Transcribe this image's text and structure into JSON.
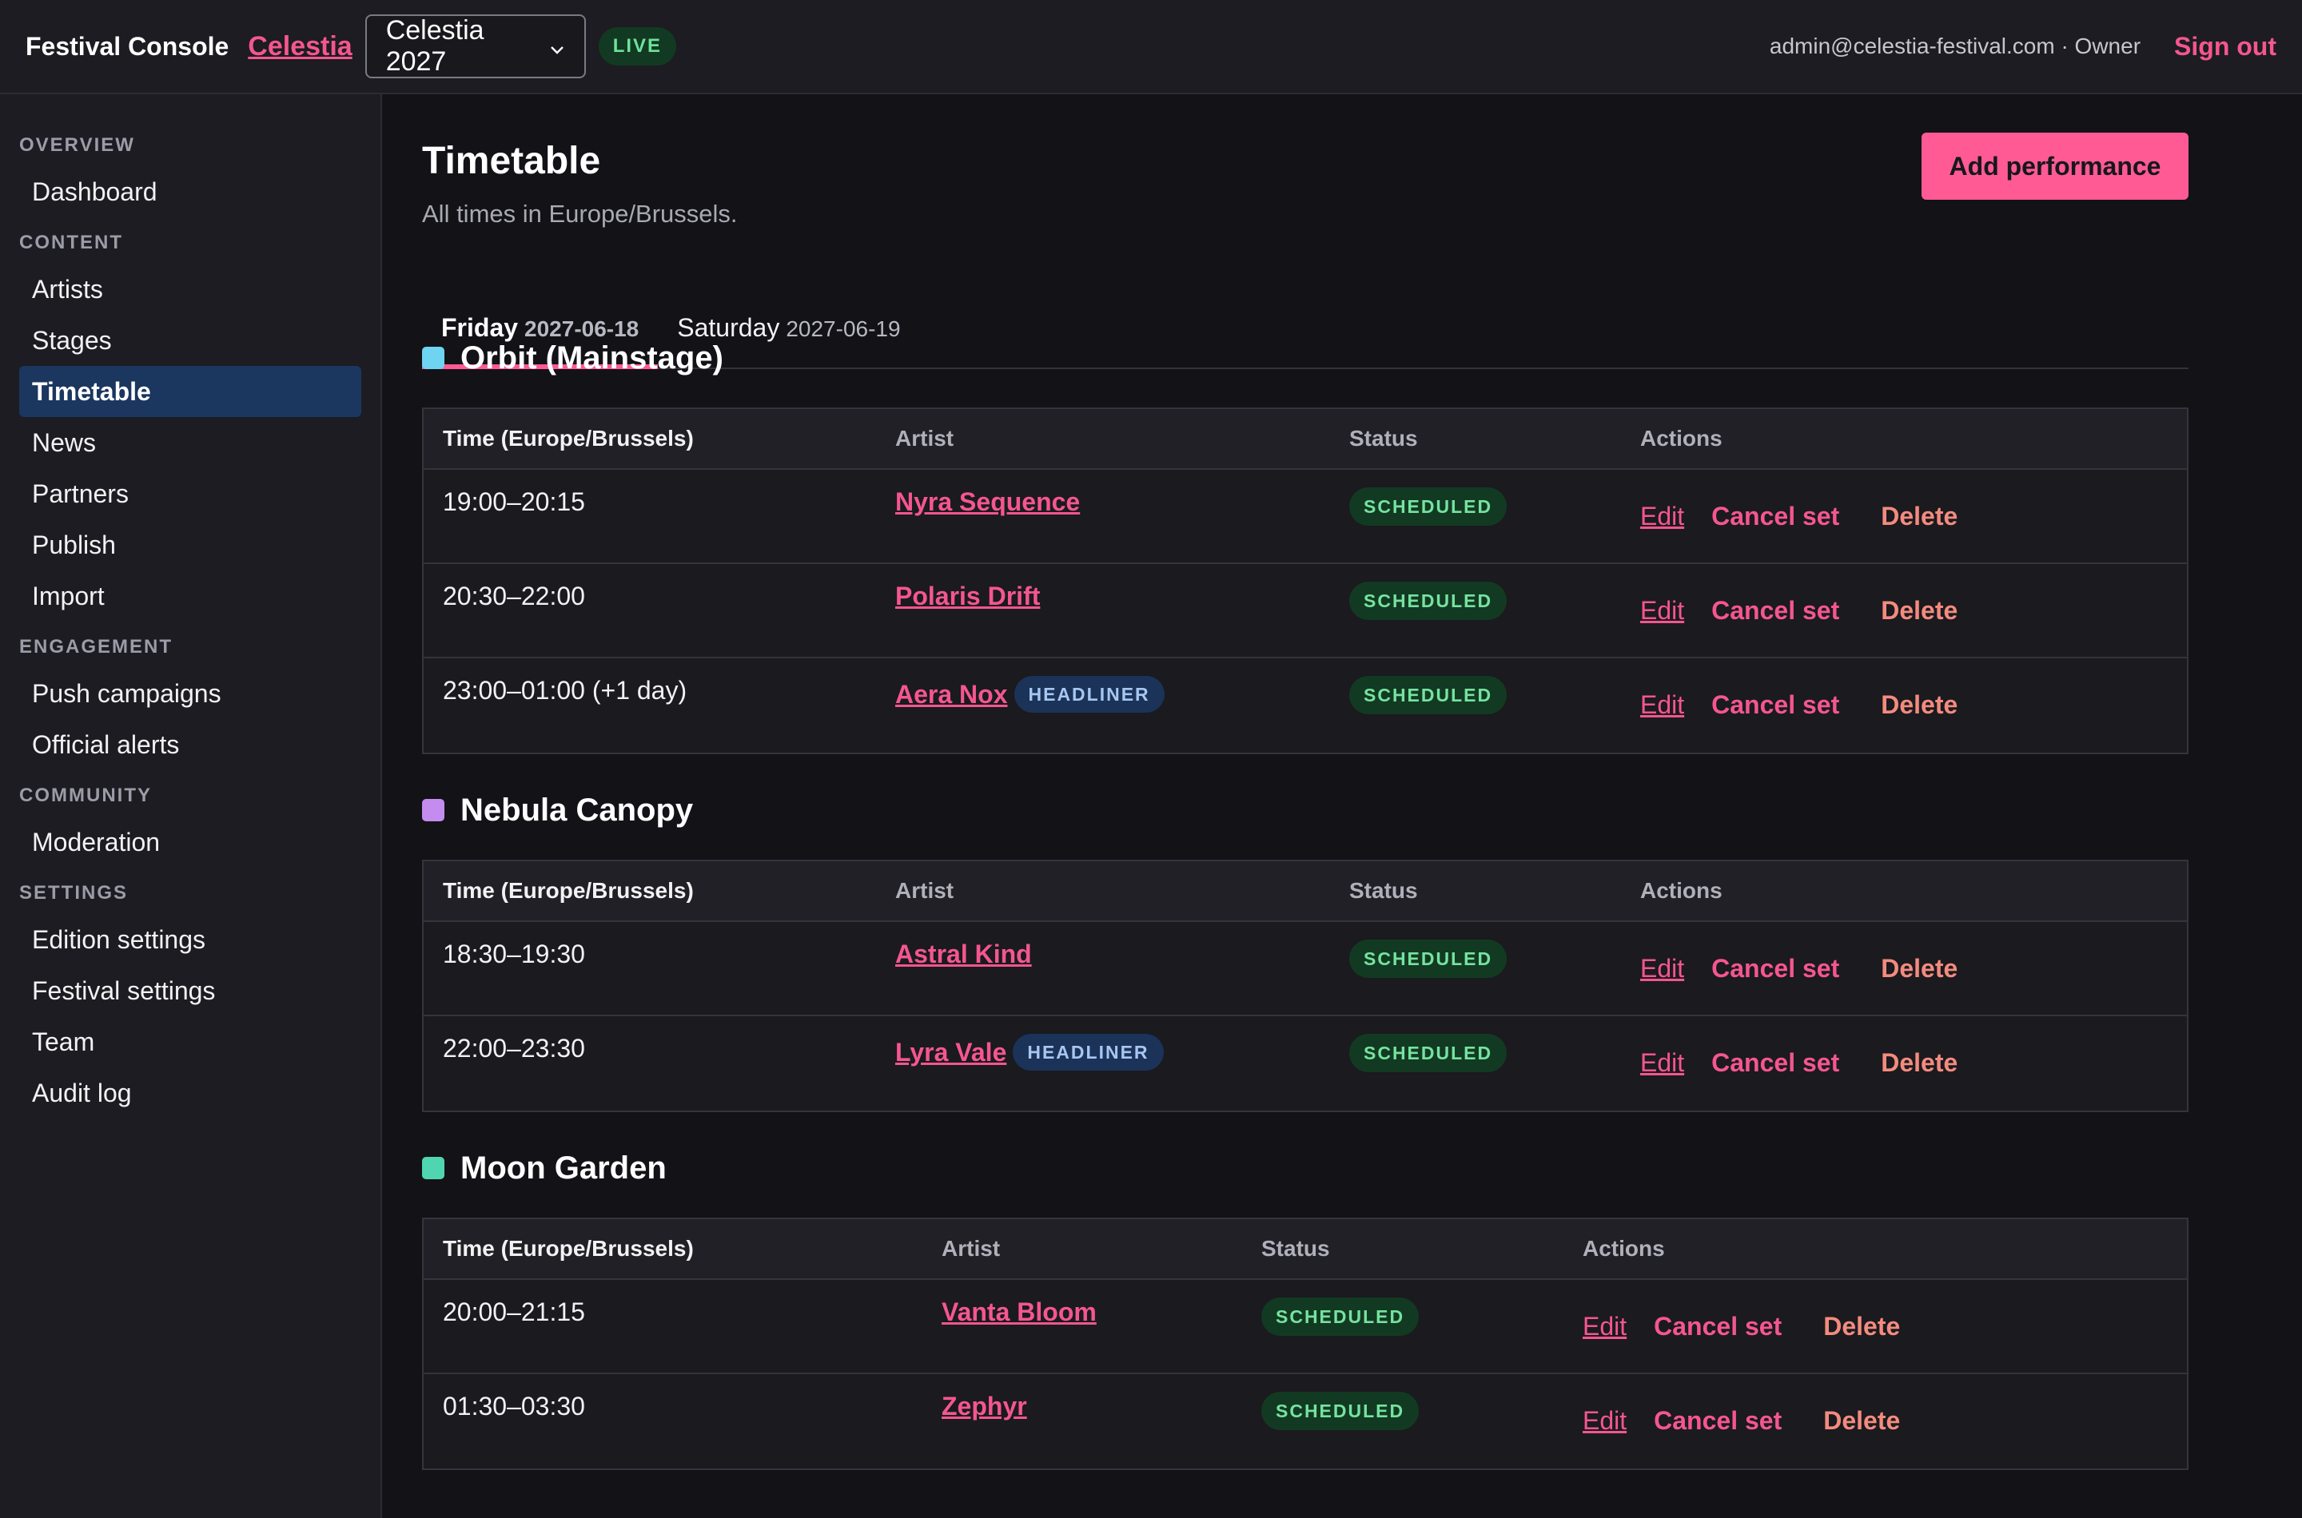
{
  "topbar": {
    "brand": "Festival Console",
    "festival_link": "Celestia",
    "edition_select": "Celestia 2027",
    "live_badge": "LIVE",
    "user_info": "admin@celestia-festival.com · Owner",
    "sign_out": "Sign out"
  },
  "sidebar": {
    "sections": [
      {
        "heading": "OVERVIEW",
        "items": [
          "Dashboard"
        ]
      },
      {
        "heading": "CONTENT",
        "items": [
          "Artists",
          "Stages",
          "Timetable",
          "News",
          "Partners",
          "Publish",
          "Import"
        ]
      },
      {
        "heading": "ENGAGEMENT",
        "items": [
          "Push campaigns",
          "Official alerts"
        ]
      },
      {
        "heading": "COMMUNITY",
        "items": [
          "Moderation"
        ]
      },
      {
        "heading": "SETTINGS",
        "items": [
          "Edition settings",
          "Festival settings",
          "Team",
          "Audit log"
        ]
      }
    ],
    "active_item": "Timetable"
  },
  "page": {
    "title": "Timetable",
    "subtitle": "All times in Europe/Brussels.",
    "add_button": "Add performance"
  },
  "tabs": [
    {
      "day": "Friday",
      "date": "2027-06-18",
      "active": true
    },
    {
      "day": "Saturday",
      "date": "2027-06-19",
      "active": false
    }
  ],
  "table_headers": {
    "time": "Time (Europe/Brussels)",
    "artist": "Artist",
    "status": "Status",
    "actions": "Actions"
  },
  "actions": {
    "edit": "Edit",
    "cancel": "Cancel set",
    "delete": "Delete"
  },
  "stages": [
    {
      "name": "Orbit (Mainstage)",
      "color": "#6fd3f2",
      "rows": [
        {
          "time": "19:00–20:15",
          "artist": "Nyra Sequence",
          "headliner": "",
          "status": "SCHEDULED"
        },
        {
          "time": "20:30–22:00",
          "artist": "Polaris Drift",
          "headliner": "",
          "status": "SCHEDULED"
        },
        {
          "time": "23:00–01:00 (+1 day)",
          "artist": "Aera Nox",
          "headliner": "HEADLINER",
          "status": "SCHEDULED"
        }
      ]
    },
    {
      "name": "Nebula Canopy",
      "color": "#c58cf0",
      "rows": [
        {
          "time": "18:30–19:30",
          "artist": "Astral Kind",
          "headliner": "",
          "status": "SCHEDULED"
        },
        {
          "time": "22:00–23:30",
          "artist": "Lyra Vale",
          "headliner": "HEADLINER",
          "status": "SCHEDULED"
        }
      ]
    },
    {
      "name": "Moon Garden",
      "color": "#4fd6b0",
      "rows": [
        {
          "time": "20:00–21:15",
          "artist": "Vanta Bloom",
          "headliner": "",
          "status": "SCHEDULED"
        },
        {
          "time": "01:30–03:30",
          "artist": "Zephyr",
          "headliner": "",
          "status": "SCHEDULED"
        }
      ]
    }
  ]
}
